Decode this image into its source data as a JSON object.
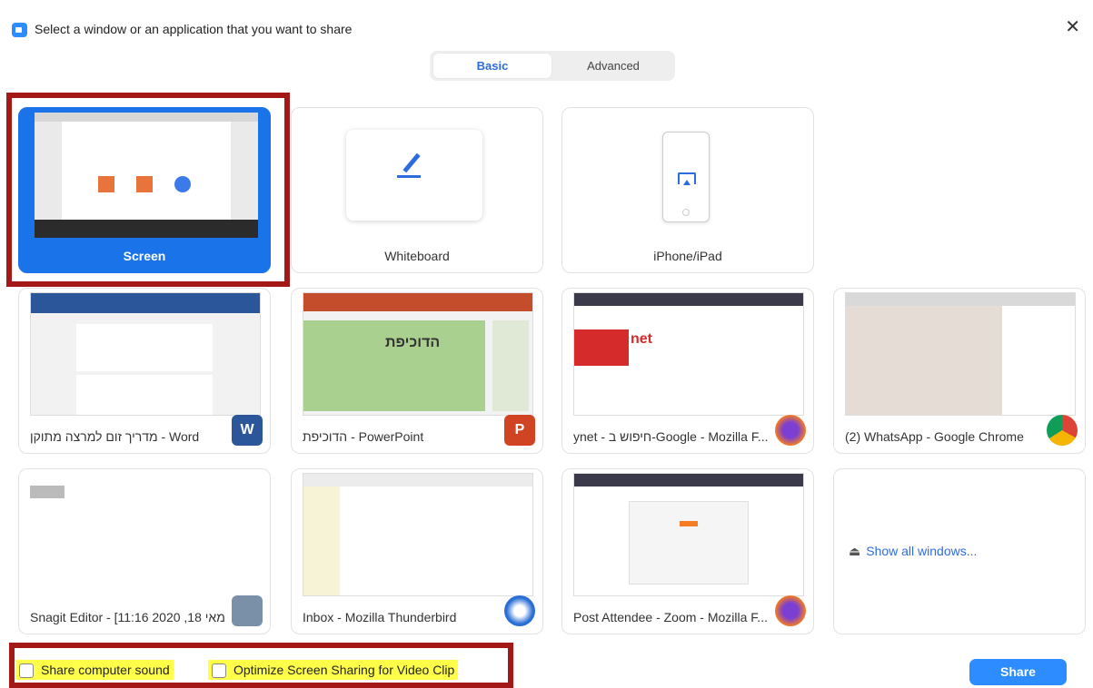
{
  "window": {
    "title": "Select a window or an application that you want to share",
    "close_glyph": "✕"
  },
  "tabs": [
    {
      "label": "Basic",
      "active": true
    },
    {
      "label": "Advanced",
      "active": false
    }
  ],
  "cards": {
    "screen": "Screen",
    "whiteboard": "Whiteboard",
    "iphone": "iPhone/iPad",
    "word": "מדריך זום למרצה מתוקן - Word",
    "powerpoint": "הדוכיפת - PowerPoint",
    "firefox_ynet": "ynet - חיפוש ב-Google - Mozilla F...",
    "whatsapp": "(2) WhatsApp - Google Chrome",
    "snagit": "Snagit Editor - [11:16 2020 ,18 מאי...",
    "thunderbird": "Inbox - Mozilla Thunderbird",
    "zoom_post": "Post Attendee - Zoom - Mozilla F...",
    "show_all": "Show all windows..."
  },
  "thumb_text": {
    "ppt_title": "הדוכיפת",
    "ynet": "net"
  },
  "options": {
    "share_sound": "Share computer sound",
    "optimize_video": "Optimize Screen Sharing for Video Clip"
  },
  "share_button": "Share",
  "badges": {
    "word": "W",
    "powerpoint": "P"
  },
  "colors": {
    "accent": "#2d8cff",
    "selected": "#1a73e8",
    "highlight": "#ffff4a",
    "annotation": "#a51818"
  }
}
